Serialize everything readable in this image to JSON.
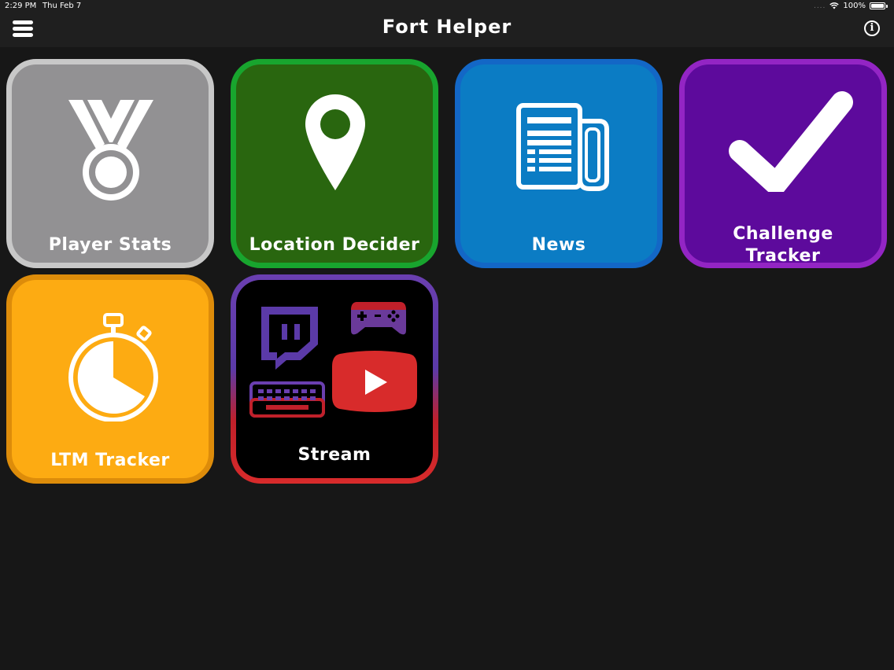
{
  "status_bar": {
    "time": "2:29 PM",
    "date": "Thu Feb 7",
    "signal": "....",
    "battery": "100%"
  },
  "navbar": {
    "title": "Fort Helper",
    "menu_icon": "hamburger-menu-icon",
    "info_icon": "info-icon",
    "info_glyph": "i"
  },
  "tiles": [
    {
      "label": "Player Stats",
      "icon": "medal-icon",
      "color": "#929193"
    },
    {
      "label": "Location Decider",
      "icon": "map-pin-icon",
      "color": "#29660f"
    },
    {
      "label": "News",
      "icon": "newspaper-icon",
      "color": "#0b7cc4"
    },
    {
      "label": "Challenge",
      "label2": "Tracker",
      "icon": "checkmark-icon",
      "color": "#5d0a9c"
    },
    {
      "label": "LTM Tracker",
      "icon": "stopwatch-icon",
      "color": "#fdab12"
    },
    {
      "label": "Stream",
      "icon": "stream-collage-icon",
      "color": "#000000"
    }
  ]
}
